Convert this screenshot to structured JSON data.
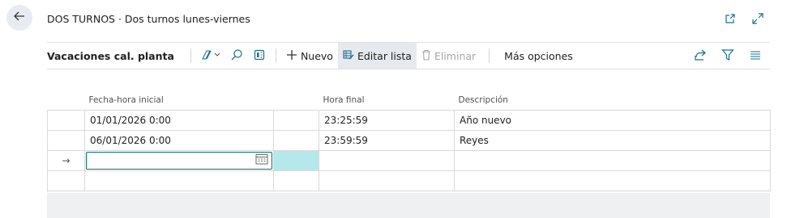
{
  "header": {
    "title": "DOS TURNOS · Dos turnos lunes-viernes"
  },
  "icons": {
    "back": "back-arrow-icon",
    "open_new_window": "open-in-new-window-icon",
    "expand": "expand-icon"
  },
  "toolbar": {
    "list_title": "Vacaciones cal. planta",
    "new_label": "Nuevo",
    "edit_list_label": "Editar lista",
    "delete_label": "Eliminar",
    "more_options_label": "Más opciones"
  },
  "table": {
    "columns": [
      "Fecha-hora inicial",
      "Hora final",
      "Descripción"
    ],
    "rows": [
      {
        "start": "01/01/2026 0:00",
        "end": "23:25:59",
        "description": "Año nuevo"
      },
      {
        "start": "06/01/2026 0:00",
        "end": "23:59:59",
        "description": "Reyes"
      },
      {
        "start": "",
        "end": "",
        "description": "",
        "selector": "→"
      },
      {
        "start": "",
        "end": "",
        "description": ""
      }
    ]
  },
  "colors": {
    "accent": "#0f6e6e",
    "active_cell_bg": "#b4e8ea",
    "toolbar_active_bg": "#e6e9ee"
  }
}
